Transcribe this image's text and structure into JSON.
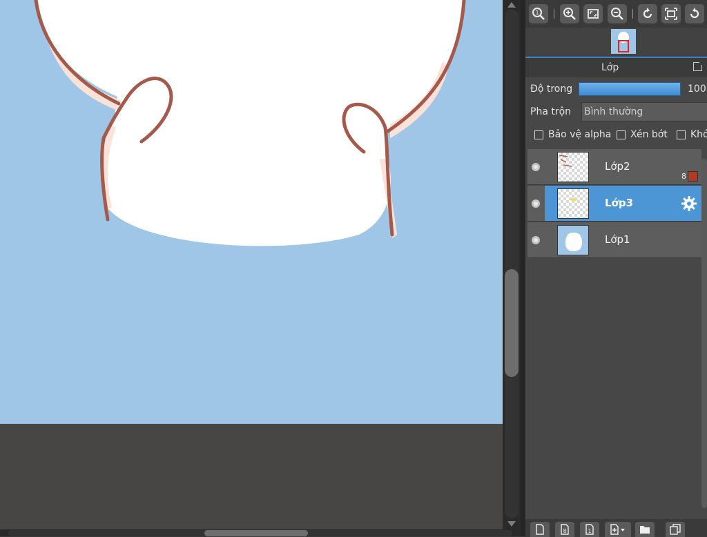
{
  "panel": {
    "layer_panel_title": "Lớp",
    "opacity_label": "Độ trong",
    "opacity_value": "100",
    "opacity_percent": 100,
    "blend_label": "Pha trộn",
    "blend_value": "Bình thường",
    "checkboxes": [
      {
        "label": "Bảo vệ alpha",
        "checked": false
      },
      {
        "label": "Xén bớt",
        "checked": false
      },
      {
        "label": "Khó",
        "checked": false
      }
    ]
  },
  "layers": [
    {
      "name": "Lớp2",
      "visible": true,
      "selected": false,
      "badge": "8",
      "badge_color": "#b03a22"
    },
    {
      "name": "Lớp3",
      "visible": true,
      "selected": true
    },
    {
      "name": "Lớp1",
      "visible": true,
      "selected": false
    }
  ],
  "toolbar": {
    "icons": [
      "zoom-actual-icon",
      "zoom-in-icon",
      "fit-screen-icon",
      "zoom-out-icon",
      "rotate-left-icon",
      "fullscreen-icon",
      "rotate-right-icon"
    ]
  },
  "footer": {
    "icons": [
      "new-layer-icon",
      "new-layer-8bit-icon",
      "new-layer-1bit-icon",
      "add-layer-menu-icon",
      "new-folder-icon",
      "duplicate-layer-icon"
    ]
  },
  "colors": {
    "canvas_background": "#9fc6e6",
    "selection_accent": "#4d96d6",
    "outline": "#a4594a"
  }
}
